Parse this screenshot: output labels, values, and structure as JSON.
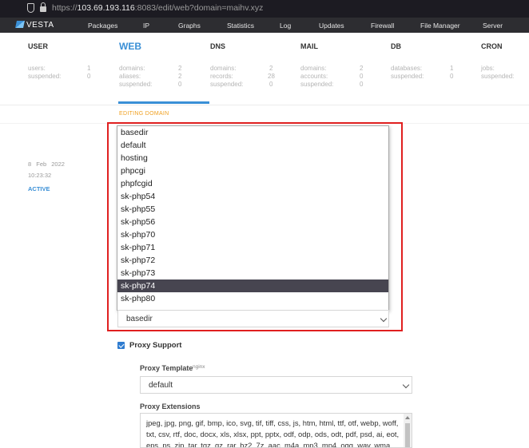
{
  "browser": {
    "url_prefix": "https://",
    "url_host": "103.69.193.116",
    "url_rest": ":8083/edit/web?domain=maihv.xyz"
  },
  "topnav": {
    "logo": "VESTA",
    "items": [
      "Packages",
      "IP",
      "Graphs",
      "Statistics",
      "Log",
      "Updates",
      "Firewall",
      "File Manager",
      "Server"
    ]
  },
  "stats": [
    {
      "title": "USER",
      "rows": [
        {
          "label": "users:",
          "value": "1"
        },
        {
          "label": "suspended:",
          "value": "0"
        }
      ]
    },
    {
      "title": "WEB",
      "rows": [
        {
          "label": "domains:",
          "value": "2"
        },
        {
          "label": "aliases:",
          "value": "2"
        },
        {
          "label": "suspended:",
          "value": "0"
        }
      ]
    },
    {
      "title": "DNS",
      "rows": [
        {
          "label": "domains:",
          "value": "2"
        },
        {
          "label": "records:",
          "value": "28"
        },
        {
          "label": "suspended:",
          "value": "0"
        }
      ]
    },
    {
      "title": "MAIL",
      "rows": [
        {
          "label": "domains:",
          "value": "2"
        },
        {
          "label": "accounts:",
          "value": "0"
        },
        {
          "label": "suspended:",
          "value": "0"
        }
      ]
    },
    {
      "title": "DB",
      "rows": [
        {
          "label": "databases:",
          "value": "1"
        },
        {
          "label": "suspended:",
          "value": "0"
        }
      ]
    },
    {
      "title": "CRON",
      "rows": [
        {
          "label": "jobs:",
          "value": ""
        },
        {
          "label": "suspended:",
          "value": ""
        }
      ]
    }
  ],
  "editing_label": "EDITING DOMAIN",
  "side": {
    "date": "8 Feb 2022",
    "time": "10:23:32",
    "status": "ACTIVE"
  },
  "template_dropdown": {
    "options": [
      "basedir",
      "default",
      "hosting",
      "phpcgi",
      "phpfcgid",
      "sk-php54",
      "sk-php55",
      "sk-php56",
      "sk-php70",
      "sk-php71",
      "sk-php72",
      "sk-php73",
      "sk-php74",
      "sk-php80"
    ],
    "highlighted": "sk-php74",
    "selected_value": "basedir"
  },
  "proxy": {
    "support_label": "Proxy Support",
    "checked": true,
    "template_label": "Proxy Template",
    "template_hint": "nginx",
    "template_value": "default",
    "extensions_label": "Proxy Extensions",
    "extensions_text": "jpeg, jpg, png, gif, bmp, ico, svg, tif, tiff, css, js, htm, html, ttf, otf, webp, woff, txt, csv, rtf, doc, docx, xls, xlsx, ppt, pptx, odf, odp, ods, odt, pdf, psd, ai, eot, eps, ps, zip, tar, tgz, gz, rar, bz2, 7z, aac, m4a, mp3, mp4, ogg, wav, wma"
  },
  "colors": {
    "accent": "#3a8fd6",
    "highlight_orange": "#f0a020",
    "selected_option_bg": "#474550",
    "callout_red": "#e02020"
  }
}
